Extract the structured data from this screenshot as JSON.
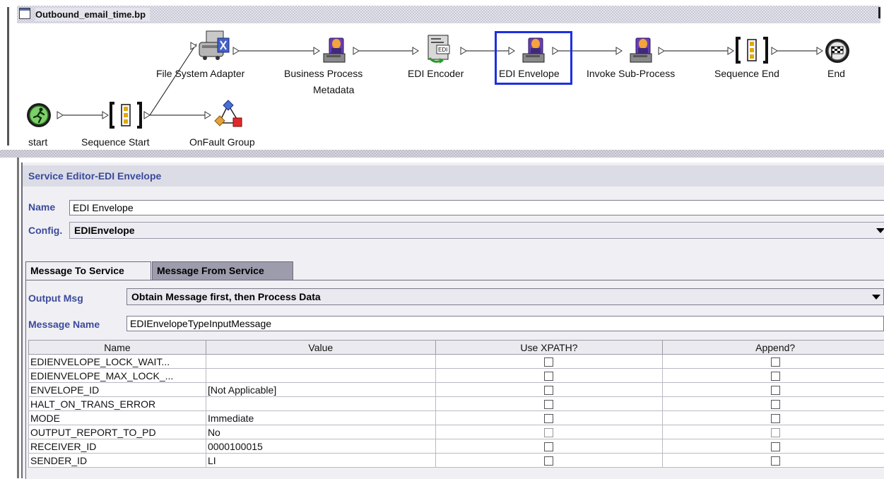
{
  "window": {
    "title": "Outbound_email_time.bp"
  },
  "nodes": [
    {
      "id": "start",
      "label": "start",
      "icon": "start-runner-icon"
    },
    {
      "id": "sequence-start",
      "label": "Sequence Start",
      "icon": "sequence-bracket-icon"
    },
    {
      "id": "file-system-adapter",
      "label": "File System Adapter",
      "icon": "adapter-icon"
    },
    {
      "id": "onfault-group",
      "label": "OnFault Group",
      "icon": "onfault-group-icon"
    },
    {
      "id": "business-process-metadata",
      "label_line1": "Business Process",
      "label_line2": "Metadata",
      "icon": "service-computer-icon"
    },
    {
      "id": "edi-encoder",
      "label": "EDI Encoder",
      "icon": "edi-document-icon"
    },
    {
      "id": "edi-envelope",
      "label": "EDI Envelope",
      "icon": "service-computer-icon",
      "selected": true
    },
    {
      "id": "invoke-sub-process",
      "label": "Invoke Sub-Process",
      "icon": "service-computer-icon"
    },
    {
      "id": "sequence-end",
      "label": "Sequence End",
      "icon": "sequence-bracket-icon"
    },
    {
      "id": "end",
      "label": "End",
      "icon": "end-flag-icon"
    }
  ],
  "editor": {
    "title": "Service Editor-EDI Envelope",
    "name_label": "Name",
    "name_value": "EDI Envelope",
    "config_label": "Config.",
    "config_value": "EDIEnvelope",
    "tabs": [
      {
        "label": "Message To Service",
        "active": true
      },
      {
        "label": "Message From Service",
        "active": false
      }
    ],
    "output_msg_label": "Output Msg",
    "output_msg_value": "Obtain Message first, then Process Data",
    "message_name_label": "Message Name",
    "message_name_value": "EDIEnvelopeTypeInputMessage",
    "table": {
      "columns": [
        "Name",
        "Value",
        "Use XPATH?",
        "Append?"
      ],
      "rows": [
        {
          "name": "EDIENVELOPE_LOCK_WAIT...",
          "value": "",
          "use_xpath": false,
          "append": false
        },
        {
          "name": "EDIENVELOPE_MAX_LOCK_...",
          "value": "",
          "use_xpath": false,
          "append": false
        },
        {
          "name": "ENVELOPE_ID",
          "value": "[Not Applicable]",
          "use_xpath": false,
          "append": false
        },
        {
          "name": "HALT_ON_TRANS_ERROR",
          "value": "",
          "use_xpath": false,
          "append": false
        },
        {
          "name": "MODE",
          "value": "Immediate",
          "use_xpath": false,
          "append": false
        },
        {
          "name": "OUTPUT_REPORT_TO_PD",
          "value": "No",
          "use_xpath": false,
          "append": false,
          "disabled": true
        },
        {
          "name": "RECEIVER_ID",
          "value": "0000100015",
          "use_xpath": false,
          "append": false
        },
        {
          "name": "SENDER_ID",
          "value": "LI",
          "use_xpath": false,
          "append": false
        }
      ]
    }
  }
}
